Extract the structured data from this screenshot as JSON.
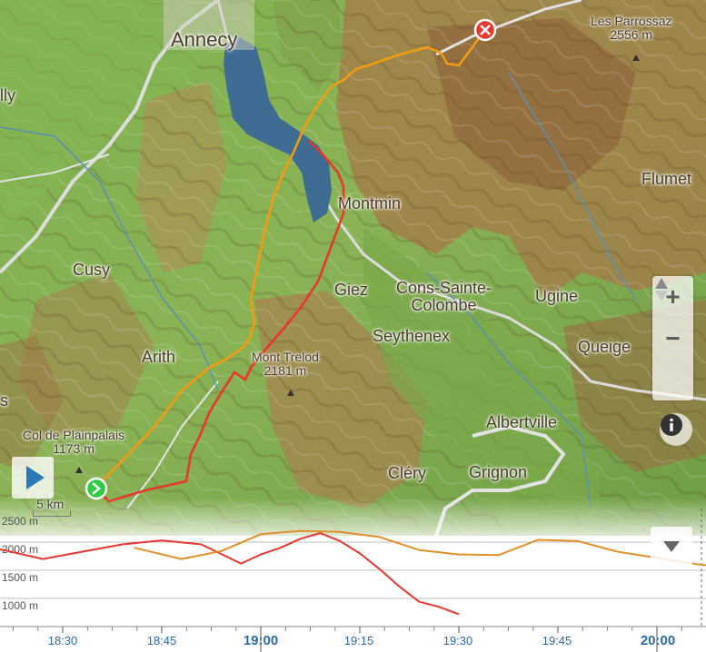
{
  "map": {
    "places": [
      {
        "id": "annecy",
        "name": "Annecy",
        "kind": "city"
      },
      {
        "id": "lly",
        "name": "lly",
        "kind": "town"
      },
      {
        "id": "les-parrossaz",
        "name": "Les Parrossaz",
        "elev": "2556 m",
        "kind": "peak"
      },
      {
        "id": "flumet",
        "name": "Flumet",
        "kind": "town"
      },
      {
        "id": "montmin",
        "name": "Montmin",
        "kind": "town"
      },
      {
        "id": "cusy",
        "name": "Cusy",
        "kind": "town"
      },
      {
        "id": "giez",
        "name": "Giez",
        "kind": "town"
      },
      {
        "id": "cons-sainte-colombe",
        "name": "Cons-Sainte-\nColombe",
        "kind": "town"
      },
      {
        "id": "ugine",
        "name": "Ugine",
        "kind": "town"
      },
      {
        "id": "seythenex",
        "name": "Seythenex",
        "kind": "town"
      },
      {
        "id": "queige",
        "name": "Queige",
        "kind": "town"
      },
      {
        "id": "arith",
        "name": "Arith",
        "kind": "town"
      },
      {
        "id": "mont-trelod",
        "name": "Mont Trelod",
        "elev": "2181 m",
        "kind": "peak"
      },
      {
        "id": "albertville",
        "name": "Albertville",
        "kind": "town"
      },
      {
        "id": "col-de-plainpalais",
        "name": "Col de Plainpalais",
        "elev": "1173 m",
        "kind": "peak"
      },
      {
        "id": "clery",
        "name": "Cléry",
        "kind": "town"
      },
      {
        "id": "grignon",
        "name": "Grignon",
        "kind": "town"
      },
      {
        "id": "edge-s",
        "name": "s",
        "kind": "town"
      }
    ],
    "scale_label": "5 km",
    "colors": {
      "track_orange": "#f39c12",
      "track_red": "#e8372c",
      "lake": "#3e6c92",
      "start": "#2ecc40",
      "end": "#e8372c"
    },
    "controls": {
      "zoom_in": "+",
      "zoom_out": "−",
      "reset_north": "▲",
      "info": "i"
    }
  },
  "profile": {
    "y_labels": [
      "2500 m",
      "2000 m",
      "1500 m",
      "1000 m"
    ],
    "x_labels": [
      "18:30",
      "18:45",
      "19:00",
      "19:15",
      "19:30",
      "19:45",
      "20:00"
    ],
    "major_x_labels": [
      "19:00",
      "20:00"
    ]
  },
  "chart_data": {
    "type": "line",
    "xlabel": "",
    "ylabel": "",
    "ylim": [
      700,
      2500
    ],
    "x_ticks": [
      "18:30",
      "18:45",
      "19:00",
      "19:15",
      "19:30",
      "19:45",
      "20:00"
    ],
    "series": [
      {
        "color": "#e8372c",
        "x": [
          18.25,
          18.35,
          18.45,
          18.55,
          18.65,
          18.75,
          18.85,
          18.95,
          19.0,
          19.05,
          19.1,
          19.15,
          19.2,
          19.25,
          19.3,
          19.35,
          19.4,
          19.45,
          19.5
        ],
        "y": [
          1990,
          1860,
          1700,
          1830,
          1960,
          2030,
          1960,
          1620,
          1780,
          1900,
          2060,
          2160,
          2020,
          1800,
          1520,
          1210,
          940,
          850,
          720
        ]
      },
      {
        "color": "#e0902a",
        "x": [
          18.68,
          18.8,
          18.9,
          19.0,
          19.1,
          19.2,
          19.3,
          19.4,
          19.5,
          19.6,
          19.7,
          19.8,
          19.9,
          20.0,
          20.1,
          20.2,
          20.3,
          20.4,
          20.5,
          20.6
        ],
        "y": [
          1900,
          1700,
          1840,
          2140,
          2200,
          2180,
          2090,
          1860,
          1780,
          1770,
          2040,
          2020,
          1830,
          1720,
          1610,
          1520,
          1490,
          1380,
          1260,
          1150
        ]
      }
    ]
  }
}
